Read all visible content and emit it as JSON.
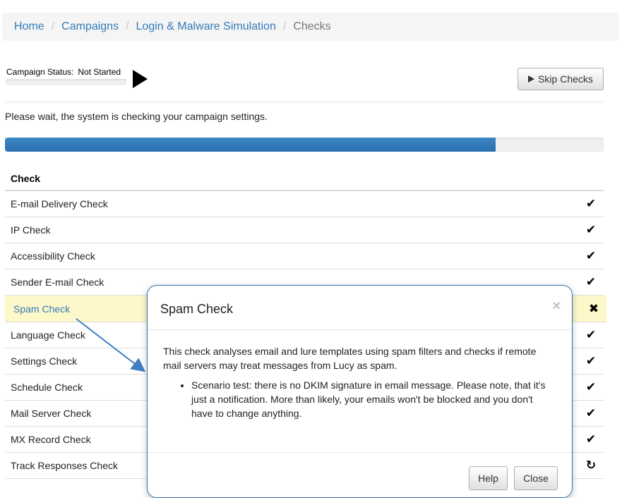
{
  "breadcrumb": {
    "home": "Home",
    "campaigns": "Campaigns",
    "campaign": "Login & Malware Simulation",
    "current": "Checks",
    "separator": "/"
  },
  "status": {
    "label": "Campaign Status:",
    "value": "Not Started",
    "progress_fraction": 0.0
  },
  "skip_button": {
    "label": "Skip Checks",
    "icon": "play-icon"
  },
  "wait_message": "Please wait, the system is checking your campaign settings.",
  "progress": {
    "fraction": 0.82,
    "color": "#337ab7"
  },
  "table": {
    "header": "Check",
    "rows": [
      {
        "label": "E-mail Delivery Check",
        "status": "check-icon",
        "glyph": "✔"
      },
      {
        "label": "IP Check",
        "status": "check-icon",
        "glyph": "✔"
      },
      {
        "label": "Accessibility Check",
        "status": "check-icon",
        "glyph": "✔"
      },
      {
        "label": "Sender E-mail Check",
        "status": "check-icon",
        "glyph": "✔"
      },
      {
        "label": "Spam Check",
        "status": "cross-icon",
        "glyph": "✖"
      },
      {
        "label": "Language Check",
        "status": "check-icon",
        "glyph": "✔"
      },
      {
        "label": "Settings Check",
        "status": "check-icon",
        "glyph": "✔"
      },
      {
        "label": "Schedule Check",
        "status": "check-icon",
        "glyph": "✔"
      },
      {
        "label": "Mail Server Check",
        "status": "check-icon",
        "glyph": "✔"
      },
      {
        "label": "MX Record Check",
        "status": "check-icon",
        "glyph": "✔"
      },
      {
        "label": "Track Responses Check",
        "status": "refresh-icon",
        "glyph": "↻"
      }
    ]
  },
  "modal": {
    "title": "Spam Check",
    "close_glyph": "×",
    "description": "This check analyses email and lure templates using spam filters and checks if remote mail servers may treat messages from Lucy as spam.",
    "bullet": "Scenario test: there is no DKIM signature in email message. Please note, that it's just a notification. More than likely, your emails won't be blocked and you don't have to change anything.",
    "help_label": "Help",
    "close_label": "Close"
  },
  "colors": {
    "link": "#337ab7",
    "highlight_row": "#fcf8c9",
    "modal_border": "#3a73ad"
  }
}
